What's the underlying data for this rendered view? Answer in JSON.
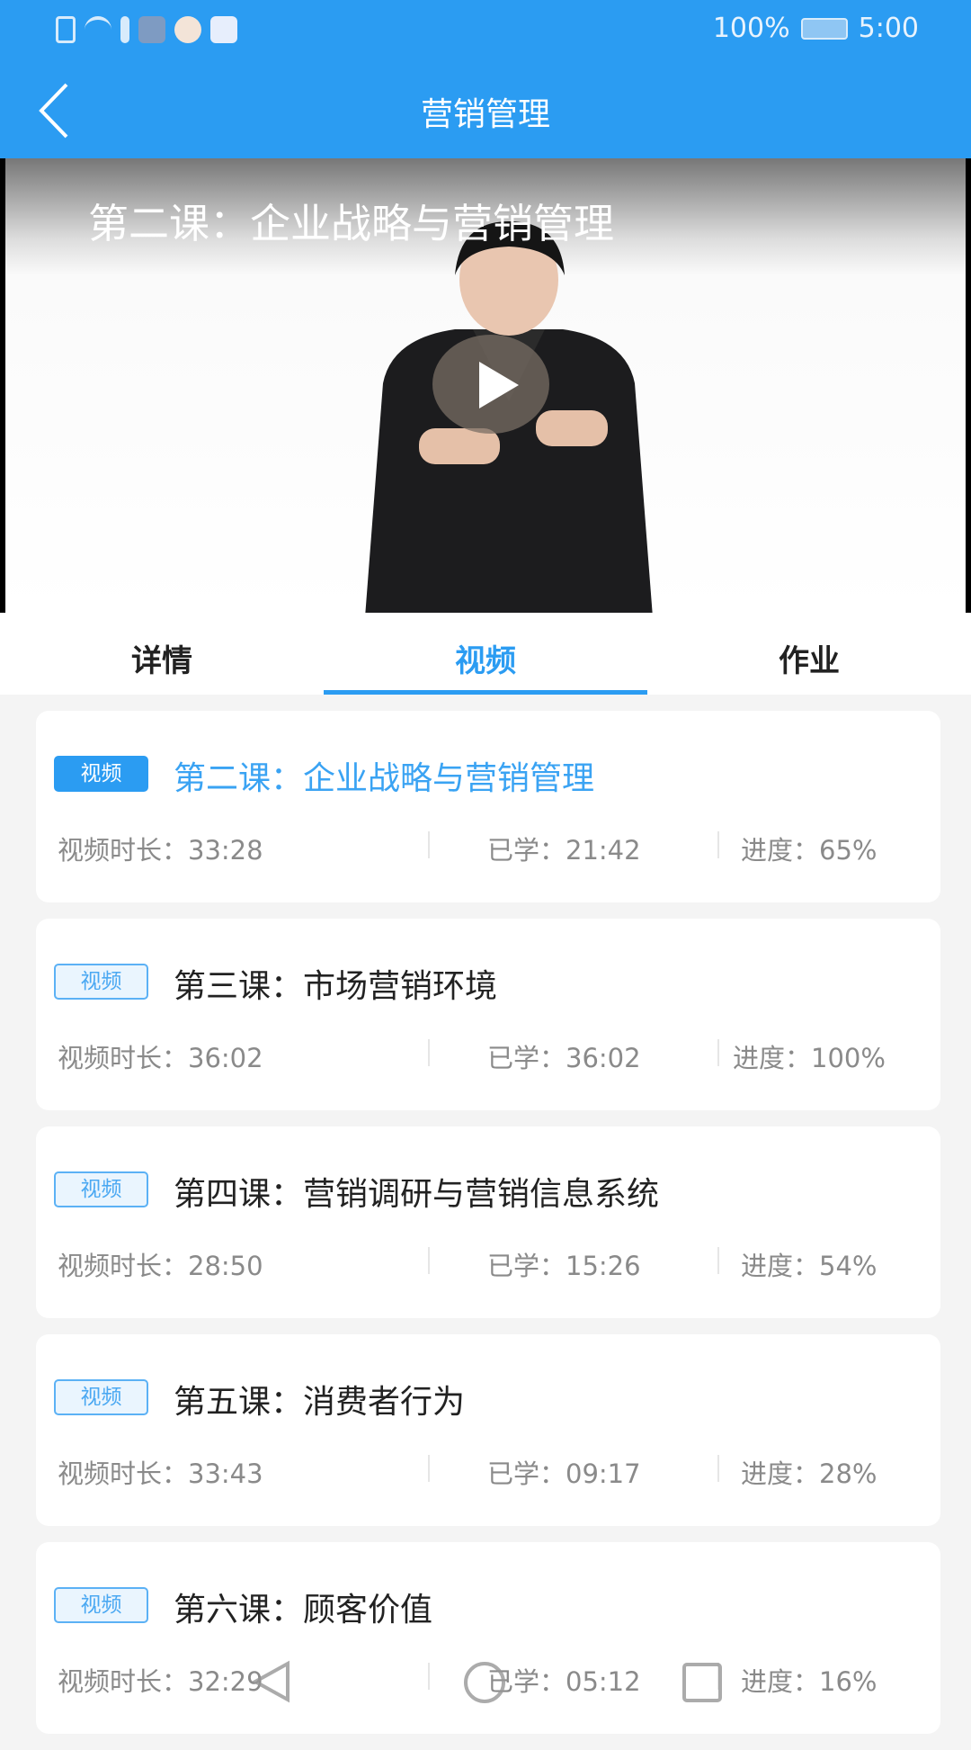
{
  "status_bar": {
    "battery": "100%",
    "time": "5:00",
    "icons": [
      "sim-alert-icon",
      "wifi-icon",
      "usb-icon",
      "app-icon",
      "map-app-icon",
      "baidu-app-icon"
    ]
  },
  "header": {
    "title": "营销管理",
    "back_icon": "chevron-left-icon"
  },
  "video": {
    "title": "第二课：企业战略与营销管理",
    "play_icon": "play-icon"
  },
  "tabs": [
    {
      "label": "详情"
    },
    {
      "label": "视频",
      "active": true
    },
    {
      "label": "作业"
    }
  ],
  "accent_color": "#2b9cf2",
  "lessons": [
    {
      "badge": "视频",
      "title": "第二课：企业战略与营销管理",
      "duration": "视频时长：33:28",
      "learned": "已学：21:42",
      "progress": "进度：65%",
      "active": true
    },
    {
      "badge": "视频",
      "title": "第三课：市场营销环境",
      "duration": "视频时长：36:02",
      "learned": "已学：36:02",
      "progress": "进度：100%"
    },
    {
      "badge": "视频",
      "title": "第四课：营销调研与营销信息系统",
      "duration": "视频时长：28:50",
      "learned": "已学：15:26",
      "progress": "进度：54%"
    },
    {
      "badge": "视频",
      "title": "第五课：消费者行为",
      "duration": "视频时长：33:43",
      "learned": "已学：09:17",
      "progress": "进度：28%"
    },
    {
      "badge": "视频",
      "title": "第六课：顾客价值",
      "duration": "视频时长：32:29",
      "learned": "已学：05:12",
      "progress": "进度：16%"
    }
  ],
  "nav_bar": [
    "back-triangle-icon",
    "home-circle-icon",
    "recents-square-icon"
  ]
}
